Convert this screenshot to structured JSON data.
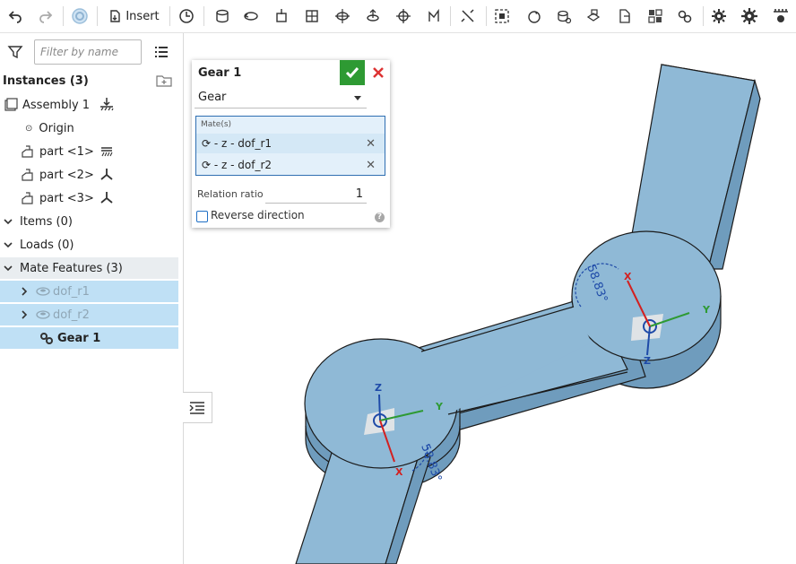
{
  "toolbar": {
    "insert_label": "Insert"
  },
  "filter": {
    "placeholder": "Filter by name"
  },
  "tree": {
    "instances_label": "Instances (3)",
    "assembly_label": "Assembly 1",
    "origin_label": "Origin",
    "parts": [
      "part <1>",
      "part <2>",
      "part <3>"
    ],
    "items_label": "Items (0)",
    "loads_label": "Loads (0)",
    "mate_features_label": "Mate Features (3)",
    "mates": [
      "dof_r1",
      "dof_r2"
    ],
    "gear_label": "Gear 1"
  },
  "dialog": {
    "title": "Gear 1",
    "type_value": "Gear",
    "mates_label": "Mate(s)",
    "mate_rows": [
      "⟳ - z - dof_r1",
      "⟳ - z - dof_r2"
    ],
    "ratio_label": "Relation ratio",
    "ratio_value": "1",
    "reverse_label": "Reverse direction",
    "help_glyph": "?"
  },
  "viewport": {
    "angle_label": "58.83°",
    "axis_x": "X",
    "axis_y": "Y",
    "axis_z": "Z"
  },
  "colors": {
    "part_top": "#8fb9d6",
    "part_side": "#6f9cbd",
    "accent": "#2e9a33",
    "selection": "#bfe0f5"
  }
}
